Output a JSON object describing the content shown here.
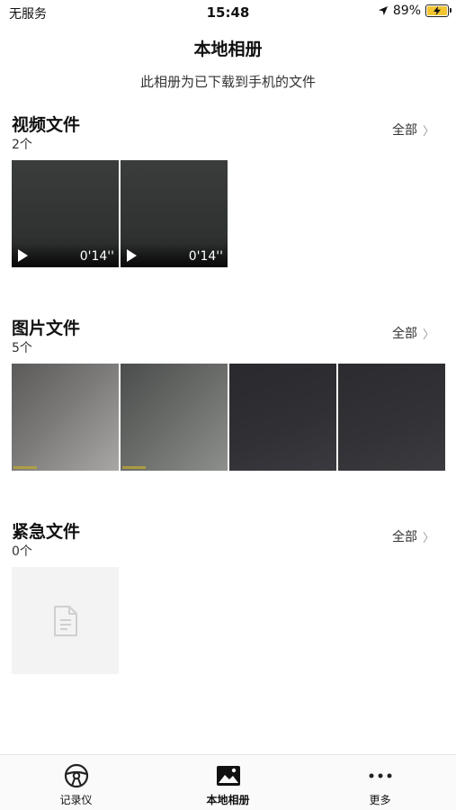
{
  "status_bar": {
    "carrier": "无服务",
    "time": "15:48",
    "battery": "89%"
  },
  "header": {
    "title": "本地相册",
    "subtitle": "此相册为已下载到手机的文件"
  },
  "view_all_label": "全部",
  "sections": {
    "videos": {
      "title": "视频文件",
      "count": "2个",
      "items": [
        {
          "duration": "0'14''"
        },
        {
          "duration": "0'14''"
        }
      ]
    },
    "photos": {
      "title": "图片文件",
      "count": "5个"
    },
    "emergency": {
      "title": "紧急文件",
      "count": "0个"
    }
  },
  "tabs": [
    {
      "label": "记录仪",
      "icon": "steering-wheel-icon"
    },
    {
      "label": "本地相册",
      "icon": "album-icon",
      "active": true
    },
    {
      "label": "更多",
      "icon": "more-dots-icon"
    }
  ],
  "colors": {
    "battery_fill": "#f2c531",
    "placeholder_bg": "#f3f3f3"
  }
}
